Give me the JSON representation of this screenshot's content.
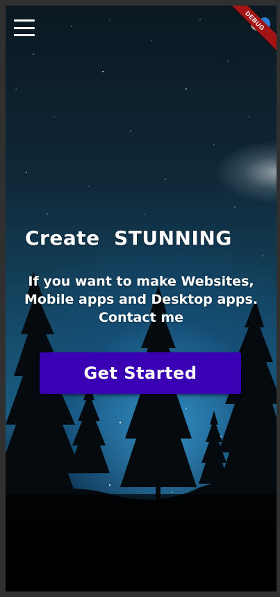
{
  "header": {
    "menu_icon": "hamburger-menu-icon",
    "logo_icon": "flutter-logo-icon",
    "debug_label": "DEBUG"
  },
  "hero": {
    "headline": "Create  STUNNING",
    "subtitle_lines": [
      "If you want to make Websites,",
      "Mobile apps and Desktop apps.",
      "Contact me"
    ],
    "cta_label": "Get Started"
  },
  "colors": {
    "cta_background": "#3a00b4",
    "debug_ribbon": "#a31515",
    "text": "#ffffff"
  }
}
